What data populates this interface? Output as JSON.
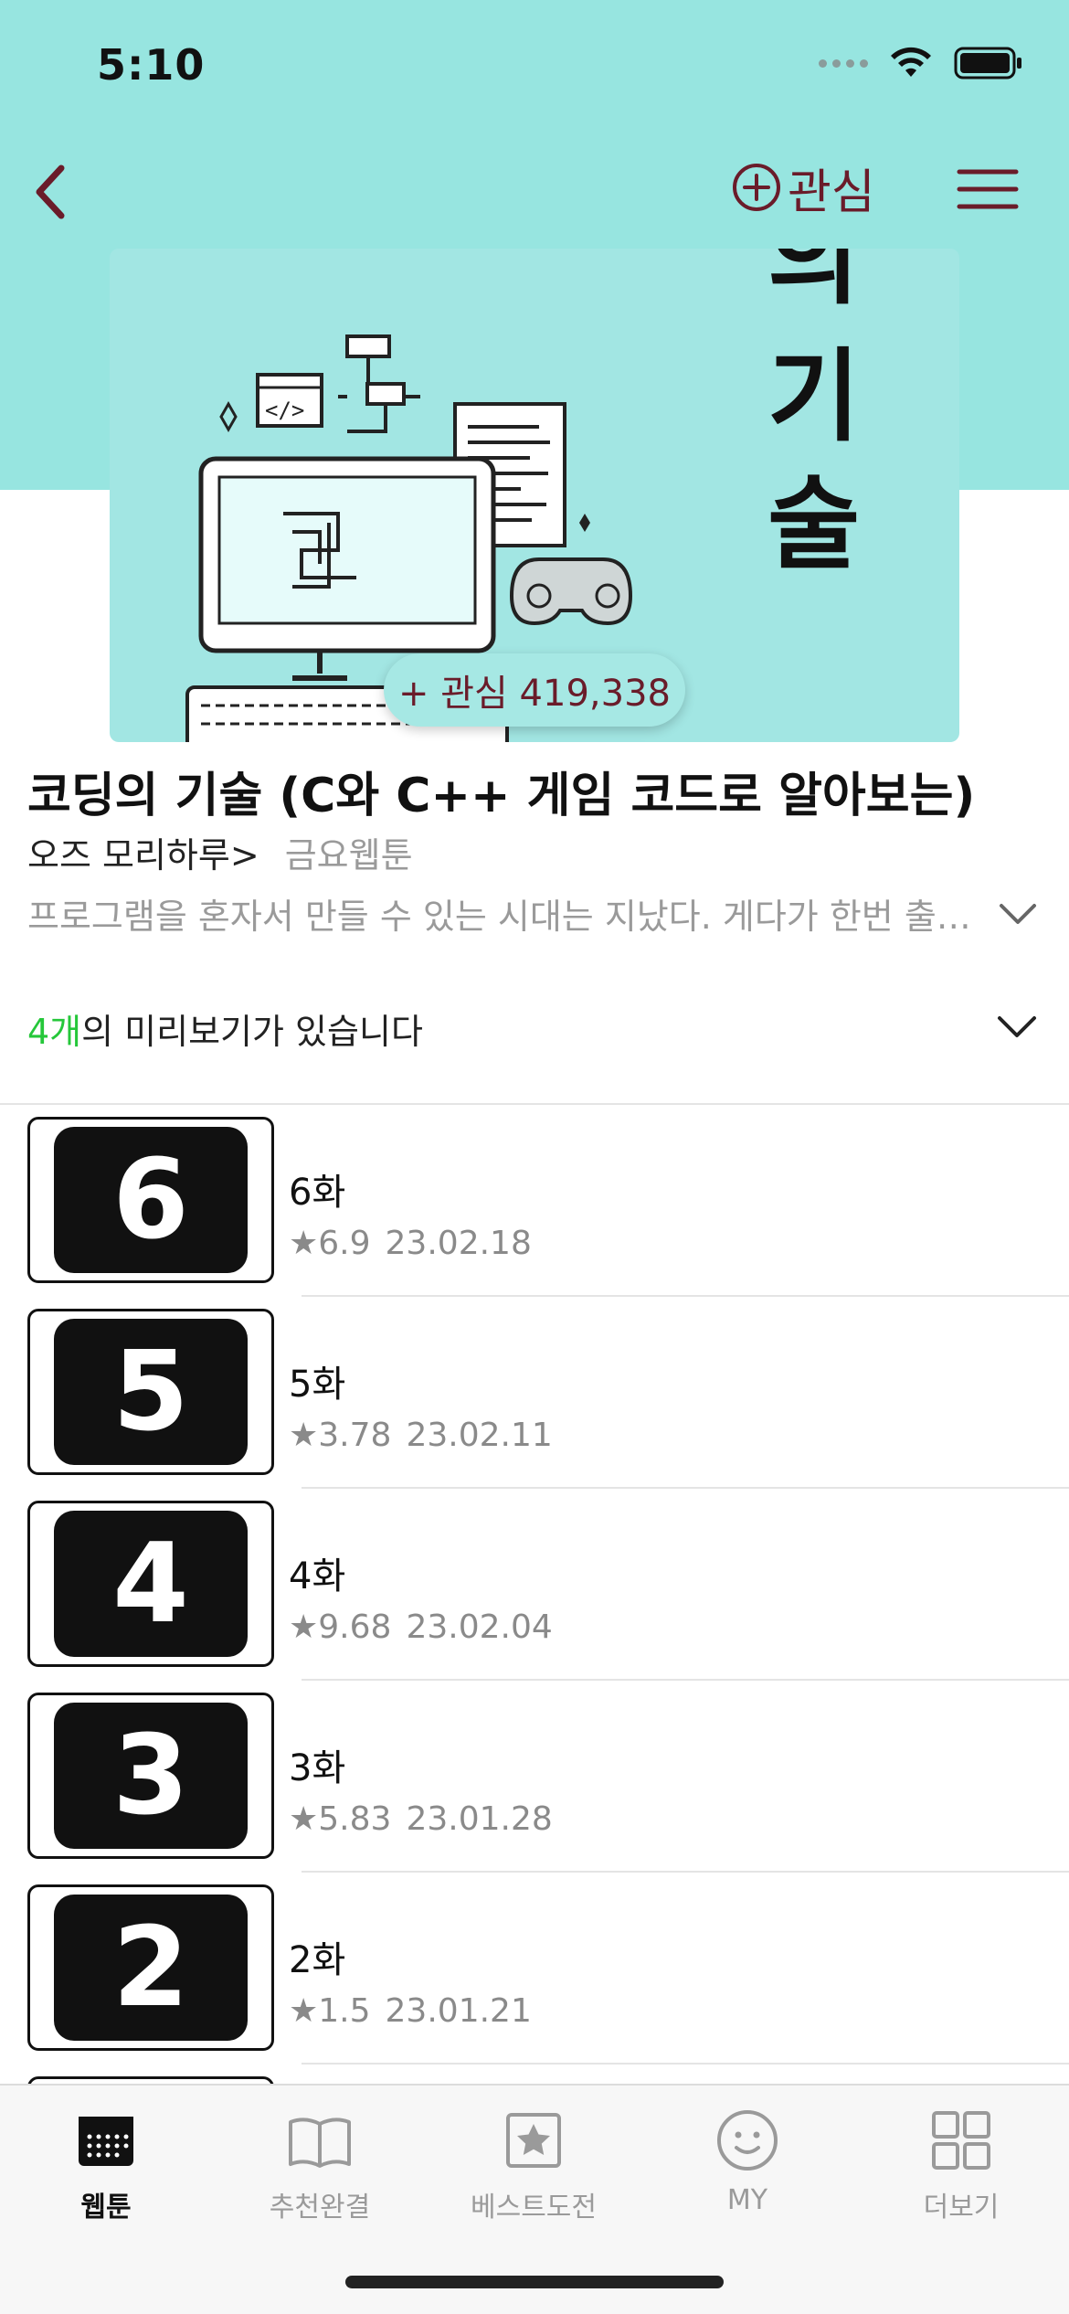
{
  "status_bar": {
    "time": "5:10"
  },
  "nav": {
    "favorite_label": "관심"
  },
  "cover": {
    "title_chars": [
      "의",
      "기",
      "술"
    ],
    "favorite_count_label": "+ 관심 419,338"
  },
  "title": "코딩의 기술 (C와 C++ 게임 코드로 알아보는)",
  "author": "오즈 모리하루>",
  "day": "금요웹툰",
  "synopsis": "프로그램을 혼자서 만들 수 있는 시대는 지났다. 게다가 한번 출시하고 끝나는 것이 아니라",
  "preview": {
    "count": "4개",
    "text": "의 미리보기가 있습니다"
  },
  "episodes": [
    {
      "number": "6",
      "title": "6화",
      "rating": "★6.9",
      "date": "23.02.18"
    },
    {
      "number": "5",
      "title": "5화",
      "rating": "★3.78",
      "date": "23.02.11"
    },
    {
      "number": "4",
      "title": "4화",
      "rating": "★9.68",
      "date": "23.02.04"
    },
    {
      "number": "3",
      "title": "3화",
      "rating": "★5.83",
      "date": "23.01.28"
    },
    {
      "number": "2",
      "title": "2화",
      "rating": "★1.5",
      "date": "23.01.21"
    }
  ],
  "tabs": [
    {
      "label": "웹툰",
      "icon": "calendar-icon",
      "active": true
    },
    {
      "label": "추천완결",
      "icon": "book-icon",
      "active": false
    },
    {
      "label": "베스트도전",
      "icon": "star-square-icon",
      "active": false
    },
    {
      "label": "MY",
      "icon": "smiley-icon",
      "active": false
    },
    {
      "label": "더보기",
      "icon": "grid-icon",
      "active": false
    }
  ],
  "colors": {
    "accent_green": "#25c73a",
    "brand_maroon": "#6a1c2a",
    "hero_teal": "#97e5e0"
  }
}
